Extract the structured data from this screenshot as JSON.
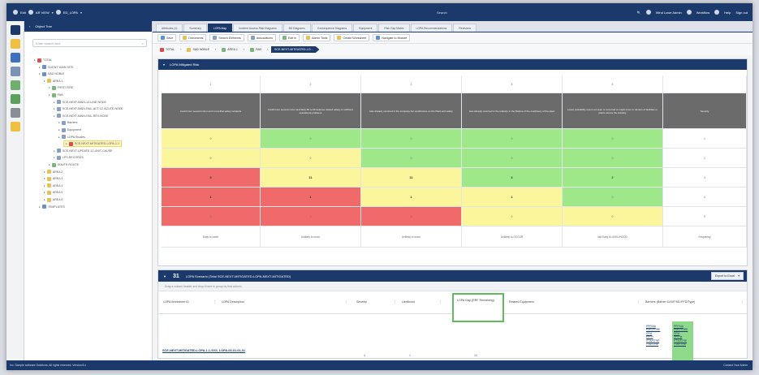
{
  "topbar": {
    "app": "Edit",
    "menu1": "AR VIEW",
    "menu2": "ED_LOPA",
    "center": "Search",
    "user": "Wind Lowe Admin",
    "r1": "Workflow",
    "r2": "Help",
    "r3": "Sign out"
  },
  "tree": {
    "header": "Object Tree",
    "search_placeholder": "Enter search text",
    "nodes": [
      {
        "label": "TOTAL",
        "indent": 0
      },
      {
        "label": "CLIENT MAIN SITE",
        "indent": 1
      },
      {
        "label": "SAD NOBLE",
        "indent": 1
      },
      {
        "label": "AREA 1",
        "indent": 2
      },
      {
        "label": "FIRST FIRE",
        "indent": 3
      },
      {
        "label": "FAB",
        "indent": 3
      },
      {
        "label": "SCE-NEXT-MAIN-12-LINE-NODE",
        "indent": 4
      },
      {
        "label": "SCE-NEXT-MAIN-FAIL-ACT 12-ACUTE-NODE",
        "indent": 4
      },
      {
        "label": "SCE-NEXT-MAIN-FAIL-REV-NODE",
        "indent": 4
      },
      {
        "label": "Barriers",
        "indent": 5
      },
      {
        "label": "Equipment",
        "indent": 5
      },
      {
        "label": "LOPA Studies",
        "indent": 5
      },
      {
        "label": "SCE-NEXT-MITIGATED-LOPA-1.1",
        "indent": 6,
        "selected": true
      },
      {
        "label": "SCE-NEXT-UPDATE-12-UNIT-CAUSE",
        "indent": 4
      },
      {
        "label": "LPS-RECORDS",
        "indent": 4
      },
      {
        "label": "SOUTH ROUTE",
        "indent": 3
      },
      {
        "label": "AREA 2",
        "indent": 2
      },
      {
        "label": "AREA 3",
        "indent": 2
      },
      {
        "label": "AREA 4",
        "indent": 2
      },
      {
        "label": "AREA 5",
        "indent": 2
      },
      {
        "label": "AREA 6",
        "indent": 2
      },
      {
        "label": "TEMPLATES",
        "indent": 1
      }
    ]
  },
  "tabs": [
    {
      "label": "Attributes (1)",
      "active": false
    },
    {
      "label": "Summary",
      "active": false
    },
    {
      "label": "LOPA Map",
      "active": true
    },
    {
      "label": "Incident Access Risk Diagrams",
      "active": false
    },
    {
      "label": "BD Diagrams",
      "active": false
    },
    {
      "label": "Consequence Diagrams",
      "active": false
    },
    {
      "label": "Equipment",
      "active": false
    },
    {
      "label": "Risk Gap Matrix",
      "active": false
    },
    {
      "label": "LOPA Recommendations",
      "active": false
    },
    {
      "label": "Revisions",
      "active": false
    }
  ],
  "toolbar": [
    {
      "label": "Save",
      "color": "#5b8fd6"
    },
    {
      "label": "Documents",
      "color": "#e8c150"
    },
    {
      "label": "Search Elements",
      "color": "#8aa0c0"
    },
    {
      "label": "Associations",
      "color": "#8aa0c0"
    },
    {
      "label": "Edit in",
      "color": "#7cb67c"
    },
    {
      "label": "Admin Tools",
      "color": "#e8c150"
    },
    {
      "label": "Create Worksheet",
      "color": "#e8c150"
    },
    {
      "label": "Navigate to Module",
      "color": "#5b8fd6"
    }
  ],
  "crumbs": [
    {
      "label": "TOTAL",
      "color": "#e04a4a"
    },
    {
      "label": "SAD NOBLE",
      "color": "#e8c150"
    },
    {
      "label": "AREA 1",
      "color": "#7cb67c"
    },
    {
      "label": "FAB",
      "color": "#7cb67c"
    },
    {
      "label": "SCE-NEXT-MITIGATED-LO...",
      "current": true
    }
  ],
  "matrix": {
    "title": "LOPA Mitigated Risk",
    "top_labels": [
      "1",
      "2",
      "3",
      "4",
      "5",
      ""
    ],
    "headers": [
      "Could incur several minor and non-lethal safety incidents",
      "Could incur several minor and fairly 50 to 50 defense related safety or sufficient operational problems",
      "Has already occurred in the company but unobtrusive on the Plant and safety",
      "Has already occurred in the industry in the lifetime of the machinery of the plant",
      "Lower probability event not seen or occurred or might occur in dozens of facilities or plants across the industry",
      "Severity"
    ],
    "rows": [
      {
        "cells": [
          "0",
          "0",
          "0",
          "0",
          "0"
        ],
        "colors": [
          "y",
          "g",
          "g",
          "g",
          "g"
        ],
        "sev": "1"
      },
      {
        "cells": [
          "0",
          "0",
          "0",
          "0",
          "0"
        ],
        "colors": [
          "y",
          "y",
          "g",
          "g",
          "g"
        ],
        "sev": "2"
      },
      {
        "cells": [
          "3",
          "11",
          "11",
          "4",
          "2"
        ],
        "colors": [
          "r",
          "y",
          "y",
          "g",
          "g"
        ],
        "sev": "3"
      },
      {
        "cells": [
          "1",
          "1",
          "1",
          "1",
          "0"
        ],
        "colors": [
          "r",
          "r",
          "y",
          "y",
          "g"
        ],
        "sev": "4"
      },
      {
        "cells": [
          "0",
          "0",
          "0",
          "0",
          "0"
        ],
        "colors": [
          "r",
          "r",
          "r",
          "y",
          "y"
        ],
        "sev": "5"
      }
    ],
    "footer": [
      "Easy to catch",
      "Unlikely to occur",
      "Unlikely to occur",
      "Unlikely to OCCUR",
      "Not Easy to LIKELIHOOD",
      "Frequency"
    ]
  },
  "lower": {
    "title": "LOPA Scenario (Total SCE-NEXT-MITIGATED-LOPA-NEXT-MITIGATED)",
    "count": "31",
    "export": "Export to Excel",
    "hint": "Drag a column header and drop it here to group by that column",
    "columns": {
      "c1": "LOPA Worksheet ID",
      "c2": "LOPA Description",
      "c3": "Severity",
      "c4": "Likelihood",
      "c5": "LOPA Gap (RRF Remaining)",
      "c6": "Related Equipment",
      "c7": "Barriers (Barrier ID/SIF/SIL/PFD/Type)"
    },
    "row": {
      "id": "SCE-NEXT-MITIGATED-LOPA-1.1-SVS_LOPA-00-01-01-01",
      "sev": "4",
      "lik": "1",
      "gap": "10",
      "barriers_a": [
        "PPF04A",
        "PDIC/TORE",
        "CFIA",
        "PPFH",
        "ITTA/STRE",
        "TTA/TTRE"
      ],
      "barriers_b": [
        "PPF04A",
        "PDIC/TORE",
        "CFIA",
        "PPFHa",
        "ITTA/STRE",
        "TTA/TTRE"
      ]
    }
  },
  "status": {
    "left": "Inc. Sample software Solutions. All rights reserved. Version 8.x",
    "right": "Contact Your Admin"
  }
}
